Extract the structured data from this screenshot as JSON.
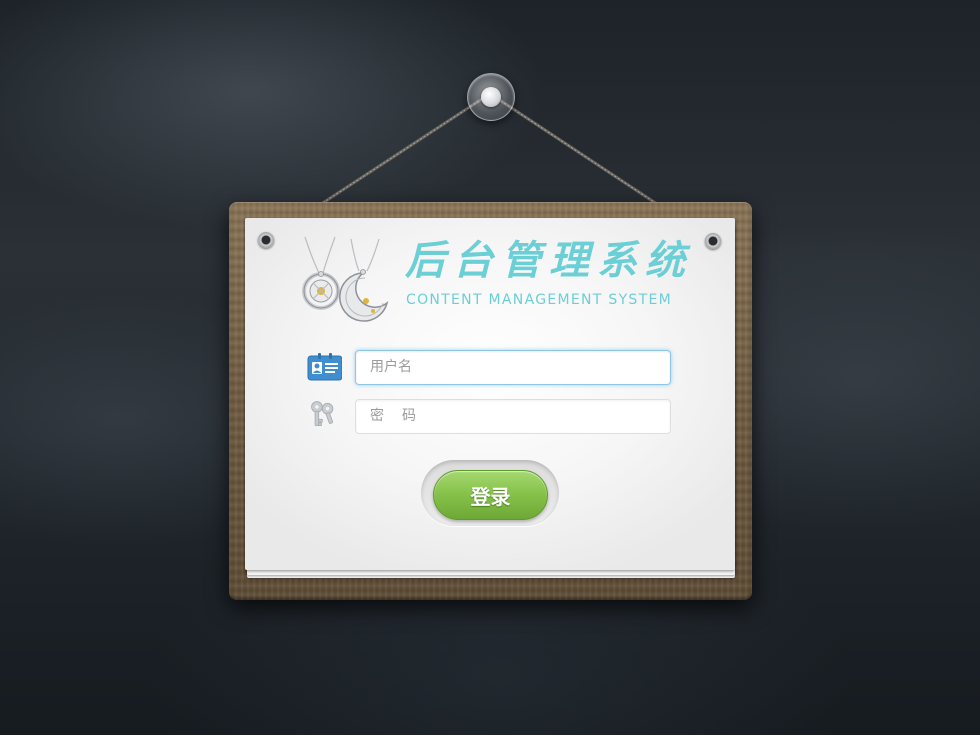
{
  "header": {
    "title_cn": "后台管理系统",
    "title_en": "CONTENT MANAGEMENT SYSTEM"
  },
  "form": {
    "username_placeholder": "用户名",
    "username_value": "",
    "password_placeholder": "密码",
    "password_value": "",
    "login_label": "登录"
  },
  "icons": {
    "pin": "pin-icon",
    "user": "user-card-icon",
    "password": "keys-icon",
    "logo": "pendant-necklaces-icon"
  },
  "colors": {
    "title": "#6ccfd6",
    "login_button": "#86c24a",
    "user_icon": "#3f8fd0",
    "focused_input_border": "#8ec7e6"
  }
}
